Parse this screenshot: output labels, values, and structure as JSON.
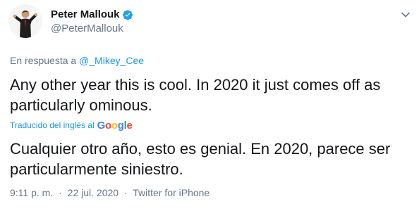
{
  "author": {
    "name": "Peter Mallouk",
    "handle": "@PeterMallouk",
    "verified": true,
    "avatar_icon": "avatar"
  },
  "reply": {
    "prefix": "En respuesta a",
    "mention": "@_Mikey_Cee"
  },
  "tweet": {
    "text": "Any other year this is cool. In 2020 it just comes off as particularly ominous."
  },
  "translation": {
    "label": "Traducido del inglés al",
    "provider": {
      "G": "G",
      "o1": "o",
      "o2": "o",
      "g": "g",
      "l": "l",
      "e": "e"
    },
    "text": "Cualquier otro año, esto es genial. En 2020, parece ser particularmente siniestro."
  },
  "meta": {
    "time": "9:11 p. m.",
    "date": "22 jul. 2020",
    "separator": "·",
    "source": "Twitter for iPhone"
  },
  "colors": {
    "link": "#1b95e0",
    "muted": "#657786",
    "text": "#14171a",
    "verified": "#1da1f2"
  }
}
